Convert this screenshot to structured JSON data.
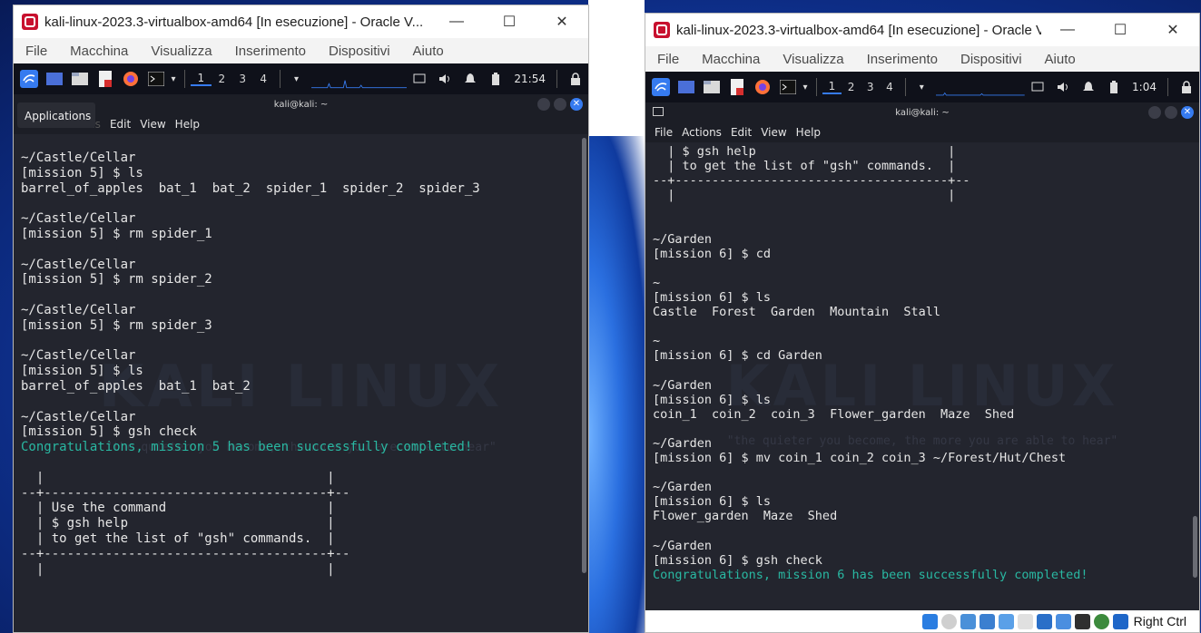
{
  "colors": {
    "accent": "#367bf0",
    "success": "#29b8a2",
    "terminal_bg": "#23252e",
    "panel_bg": "#0f111a"
  },
  "left_window": {
    "title": "kali-linux-2023.3-virtualbox-amd64 [In esecuzione] - Oracle V...",
    "controls": {
      "minimize": "—",
      "maximize": "☐",
      "close": "✕"
    },
    "menu": [
      "File",
      "Macchina",
      "Visualizza",
      "Inserimento",
      "Dispositivi",
      "Aiuto"
    ],
    "panel": {
      "workspaces": [
        "1",
        "2",
        "3",
        "4"
      ],
      "clock": "21:54"
    },
    "tooltip": "Applications",
    "terminal": {
      "title": "kali@kali: ~",
      "menu": [
        "File",
        "Actions",
        "Edit",
        "View",
        "Help"
      ],
      "lines_before": "~/Castle/Cellar\n[mission 5] $ ls\nbarrel_of_apples  bat_1  bat_2  spider_1  spider_2  spider_3\n\n~/Castle/Cellar\n[mission 5] $ rm spider_1\n\n~/Castle/Cellar\n[mission 5] $ rm spider_2\n\n~/Castle/Cellar\n[mission 5] $ rm spider_3\n\n~/Castle/Cellar\n[mission 5] $ ls\nbarrel_of_apples  bat_1  bat_2\n\n~/Castle/Cellar\n[mission 5] $ gsh check\n",
      "success": "Congratulations, mission 5 has been successfully completed!",
      "lines_after": "\n\n  |                                     |\n--+-------------------------------------+--\n  | Use the command                     |\n  | $ gsh help                          |\n  | to get the list of \"gsh\" commands.  |\n--+-------------------------------------+--\n  |                                     |"
    }
  },
  "right_window": {
    "title": "kali-linux-2023.3-virtualbox-amd64 [In esecuzione] - Oracle V...",
    "controls": {
      "minimize": "—",
      "maximize": "☐",
      "close": "✕"
    },
    "menu": [
      "File",
      "Macchina",
      "Visualizza",
      "Inserimento",
      "Dispositivi",
      "Aiuto"
    ],
    "panel": {
      "workspaces": [
        "1",
        "2",
        "3",
        "4"
      ],
      "clock": "1:04"
    },
    "terminal": {
      "title": "kali@kali: ~",
      "menu": [
        "File",
        "Actions",
        "Edit",
        "View",
        "Help"
      ],
      "lines_before": "  | $ gsh help                          |\n  | to get the list of \"gsh\" commands.  |\n--+-------------------------------------+--\n  |                                     |\n\n\n~/Garden\n[mission 6] $ cd\n\n~\n[mission 6] $ ls\nCastle  Forest  Garden  Mountain  Stall\n\n~\n[mission 6] $ cd Garden\n\n~/Garden\n[mission 6] $ ls\ncoin_1  coin_2  coin_3  Flower_garden  Maze  Shed\n\n~/Garden\n[mission 6] $ mv coin_1 coin_2 coin_3 ~/Forest/Hut/Chest\n\n~/Garden\n[mission 6] $ ls\nFlower_garden  Maze  Shed\n\n~/Garden\n[mission 6] $ gsh check\n",
      "success": "Congratulations, mission 6 has been successfully completed!"
    },
    "statusbar": {
      "host_key": "Right Ctrl"
    }
  },
  "wallpaper": {
    "logo": "KALI LINUX",
    "tagline": "\"the quieter you become, the more you are able to hear\""
  }
}
